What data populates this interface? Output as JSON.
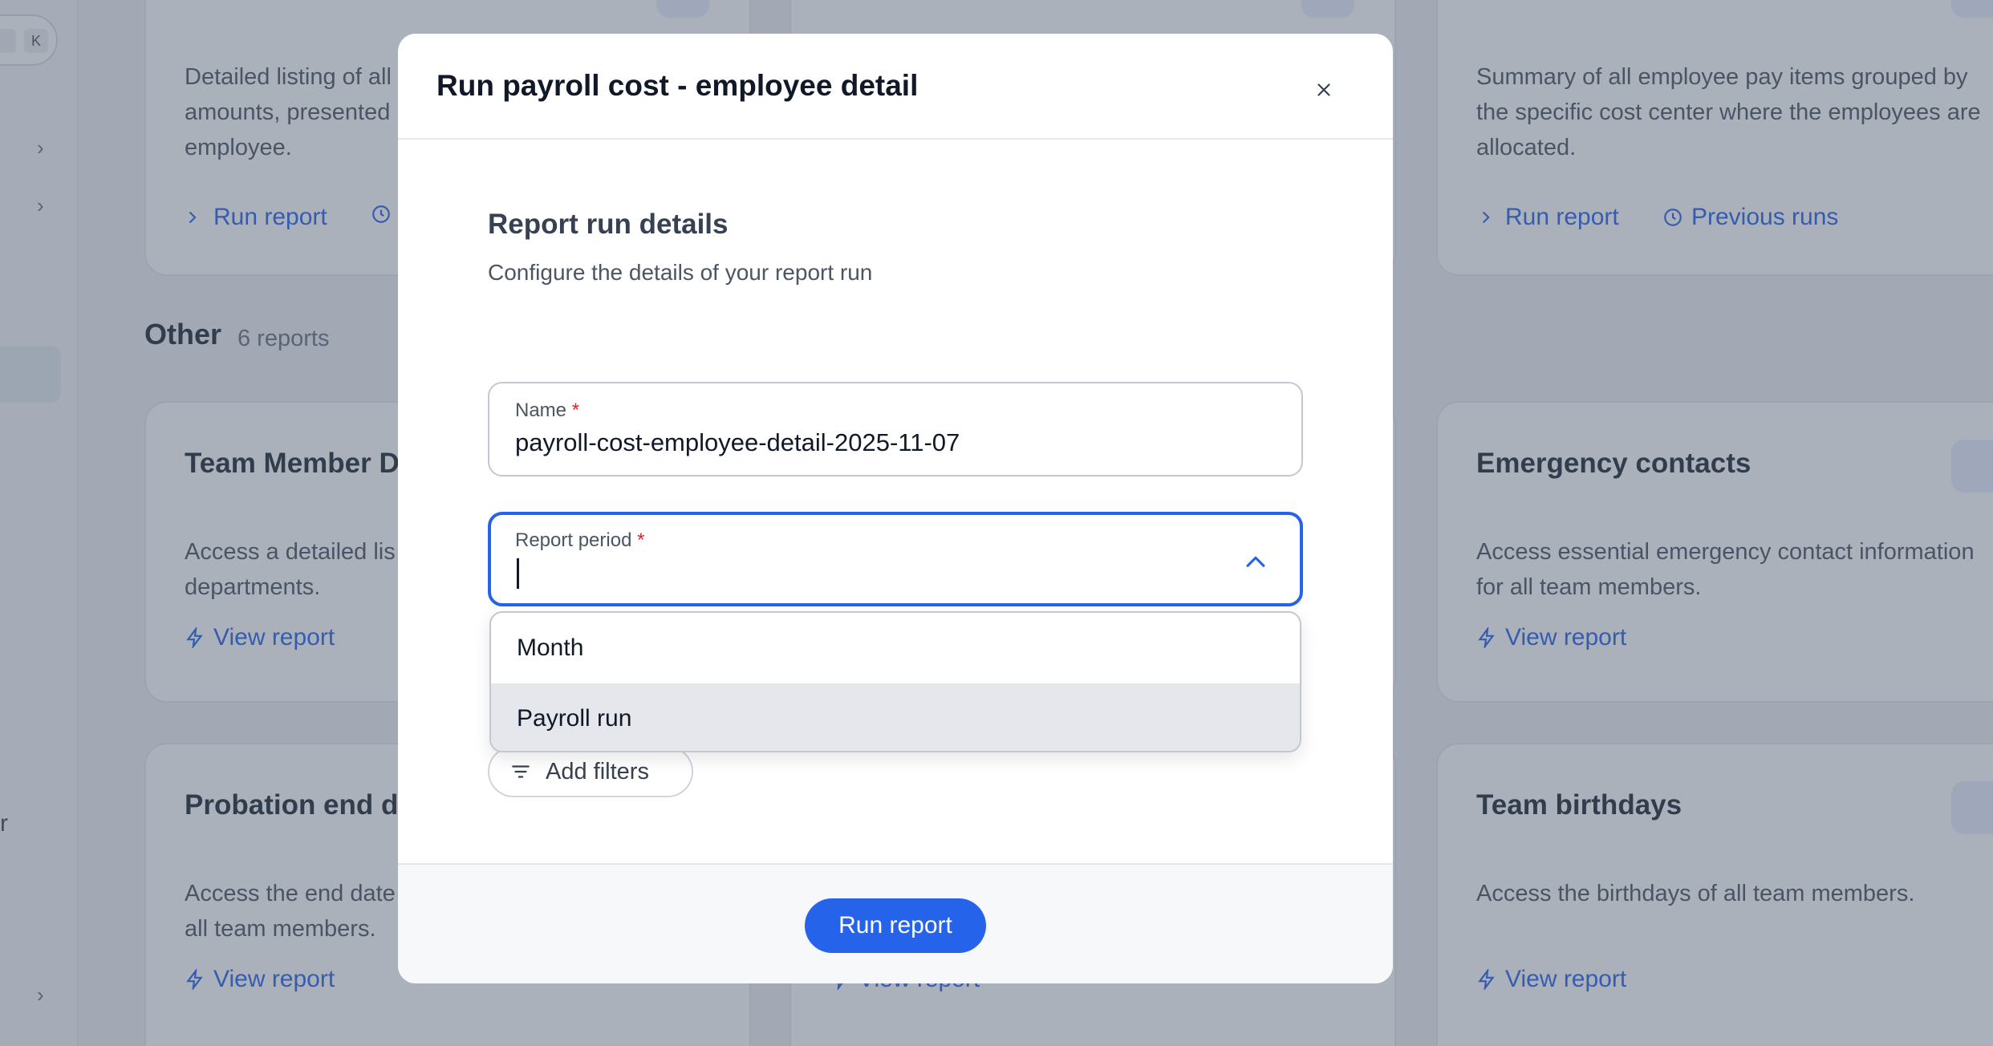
{
  "background": {
    "sidebar": {
      "kbd_key": "K",
      "partial_letter": "r"
    },
    "top_cards": [
      {
        "desc_lines": [
          "Detailed listing of all",
          "amounts, presented",
          "employee."
        ],
        "run_label": "Run report"
      },
      {
        "desc_lines": [
          "Summary of all employee pay items grouped by",
          "the specific cost center where the employees are",
          "allocated."
        ],
        "run_label": "Run report",
        "previous_label": "Previous runs"
      }
    ],
    "section": {
      "title": "Other",
      "count": "6 reports"
    },
    "cards": [
      {
        "title": "Team Member D",
        "desc_lines": [
          "Access a detailed lis",
          "departments."
        ],
        "link": "View report"
      },
      {
        "title": "Emergency contacts",
        "desc_lines": [
          "Access essential emergency contact information",
          "for all team members."
        ],
        "link": "View report"
      },
      {
        "title": "Probation end d",
        "desc_lines": [
          "Access the end date",
          "all team members."
        ],
        "link": "View report"
      },
      {
        "title": "Team birthdays",
        "desc_lines": [
          "Access the birthdays of all team members."
        ],
        "link": "View report"
      },
      {
        "link": "View report"
      }
    ]
  },
  "modal": {
    "title": "Run payroll cost - employee detail",
    "section_heading": "Report run details",
    "section_subtitle": "Configure the details of your report run",
    "name_field": {
      "label": "Name",
      "required_mark": "*",
      "value": "payroll-cost-employee-detail-2025-11-07"
    },
    "period_field": {
      "label": "Report period",
      "required_mark": "*",
      "value": ""
    },
    "period_options": [
      "Month",
      "Payroll run"
    ],
    "add_filters_label": "Add filters",
    "run_button_label": "Run report"
  },
  "colors": {
    "accent": "#2563eb",
    "required": "#dc2626",
    "overlay": "#475569"
  }
}
